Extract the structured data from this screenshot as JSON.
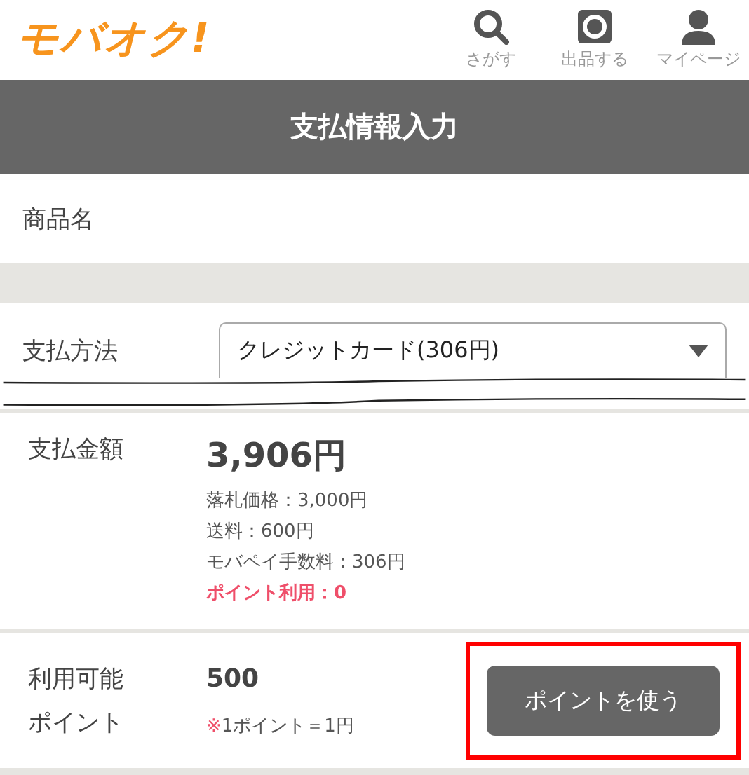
{
  "header": {
    "logo": "モバオク!",
    "nav": [
      {
        "kind": "search",
        "label": "さがす"
      },
      {
        "kind": "camera",
        "label": "出品する"
      },
      {
        "kind": "person",
        "label": "マイページ"
      }
    ]
  },
  "title": "支払情報入力",
  "product": {
    "label": "商品名"
  },
  "payment_method": {
    "label": "支払方法",
    "value": "クレジットカード(306円)"
  },
  "amount": {
    "label": "支払金額",
    "total": "3,906円",
    "details": [
      {
        "text": "落札価格：3,000円",
        "highlighted": false
      },
      {
        "text": "送料：600円",
        "highlighted": false
      },
      {
        "text": "モバペイ手数料：306円",
        "highlighted": false
      },
      {
        "text": "ポイント利用：0",
        "highlighted": true
      }
    ]
  },
  "points": {
    "label_lines": [
      "利用可能",
      "ポイント"
    ],
    "value": "500",
    "note_mark": "※",
    "note": "1ポイント＝1円",
    "button": {
      "label": "ポイントを使う",
      "highlighted": true
    }
  }
}
